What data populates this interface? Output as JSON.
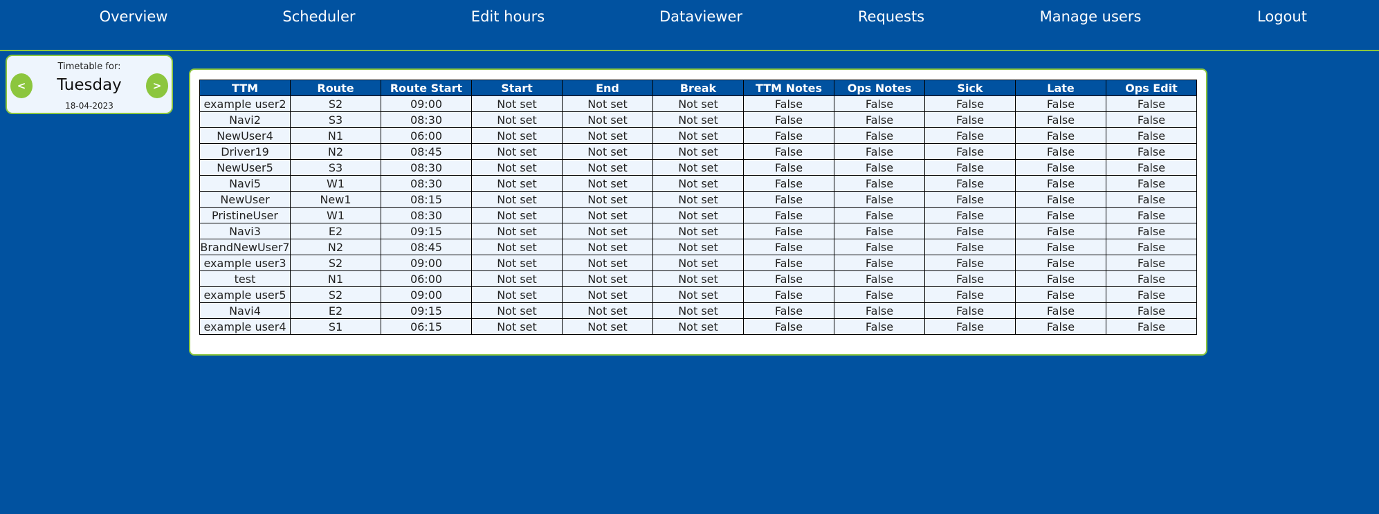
{
  "nav": {
    "items": [
      {
        "label": "Overview",
        "key": "overview"
      },
      {
        "label": "Scheduler",
        "key": "scheduler"
      },
      {
        "label": "Edit hours",
        "key": "edit-hours"
      },
      {
        "label": "Dataviewer",
        "key": "dataviewer"
      },
      {
        "label": "Requests",
        "key": "requests"
      },
      {
        "label": "Manage users",
        "key": "manage-users"
      },
      {
        "label": "Logout",
        "key": "logout"
      }
    ]
  },
  "date_panel": {
    "label": "Timetable for:",
    "day": "Tuesday",
    "date": "18-04-2023",
    "prev_label": "<",
    "next_label": ">"
  },
  "table": {
    "headers": [
      "TTM",
      "Route",
      "Route Start",
      "Start",
      "End",
      "Break",
      "TTM Notes",
      "Ops Notes",
      "Sick",
      "Late",
      "Ops Edit"
    ],
    "rows": [
      [
        "example user2",
        "S2",
        "09:00",
        "Not set",
        "Not set",
        "Not set",
        "False",
        "False",
        "False",
        "False",
        "False"
      ],
      [
        "Navi2",
        "S3",
        "08:30",
        "Not set",
        "Not set",
        "Not set",
        "False",
        "False",
        "False",
        "False",
        "False"
      ],
      [
        "NewUser4",
        "N1",
        "06:00",
        "Not set",
        "Not set",
        "Not set",
        "False",
        "False",
        "False",
        "False",
        "False"
      ],
      [
        "Driver19",
        "N2",
        "08:45",
        "Not set",
        "Not set",
        "Not set",
        "False",
        "False",
        "False",
        "False",
        "False"
      ],
      [
        "NewUser5",
        "S3",
        "08:30",
        "Not set",
        "Not set",
        "Not set",
        "False",
        "False",
        "False",
        "False",
        "False"
      ],
      [
        "Navi5",
        "W1",
        "08:30",
        "Not set",
        "Not set",
        "Not set",
        "False",
        "False",
        "False",
        "False",
        "False"
      ],
      [
        "NewUser",
        "New1",
        "08:15",
        "Not set",
        "Not set",
        "Not set",
        "False",
        "False",
        "False",
        "False",
        "False"
      ],
      [
        "PristineUser",
        "W1",
        "08:30",
        "Not set",
        "Not set",
        "Not set",
        "False",
        "False",
        "False",
        "False",
        "False"
      ],
      [
        "Navi3",
        "E2",
        "09:15",
        "Not set",
        "Not set",
        "Not set",
        "False",
        "False",
        "False",
        "False",
        "False"
      ],
      [
        "BrandNewUser7",
        "N2",
        "08:45",
        "Not set",
        "Not set",
        "Not set",
        "False",
        "False",
        "False",
        "False",
        "False"
      ],
      [
        "example user3",
        "S2",
        "09:00",
        "Not set",
        "Not set",
        "Not set",
        "False",
        "False",
        "False",
        "False",
        "False"
      ],
      [
        "test",
        "N1",
        "06:00",
        "Not set",
        "Not set",
        "Not set",
        "False",
        "False",
        "False",
        "False",
        "False"
      ],
      [
        "example user5",
        "S2",
        "09:00",
        "Not set",
        "Not set",
        "Not set",
        "False",
        "False",
        "False",
        "False",
        "False"
      ],
      [
        "Navi4",
        "E2",
        "09:15",
        "Not set",
        "Not set",
        "Not set",
        "False",
        "False",
        "False",
        "False",
        "False"
      ],
      [
        "example user4",
        "S1",
        "06:15",
        "Not set",
        "Not set",
        "Not set",
        "False",
        "False",
        "False",
        "False",
        "False"
      ]
    ]
  },
  "colors": {
    "background": "#0152a0",
    "accent": "#8cc63e",
    "panel": "#eef5fd",
    "header": "#0152a0"
  }
}
